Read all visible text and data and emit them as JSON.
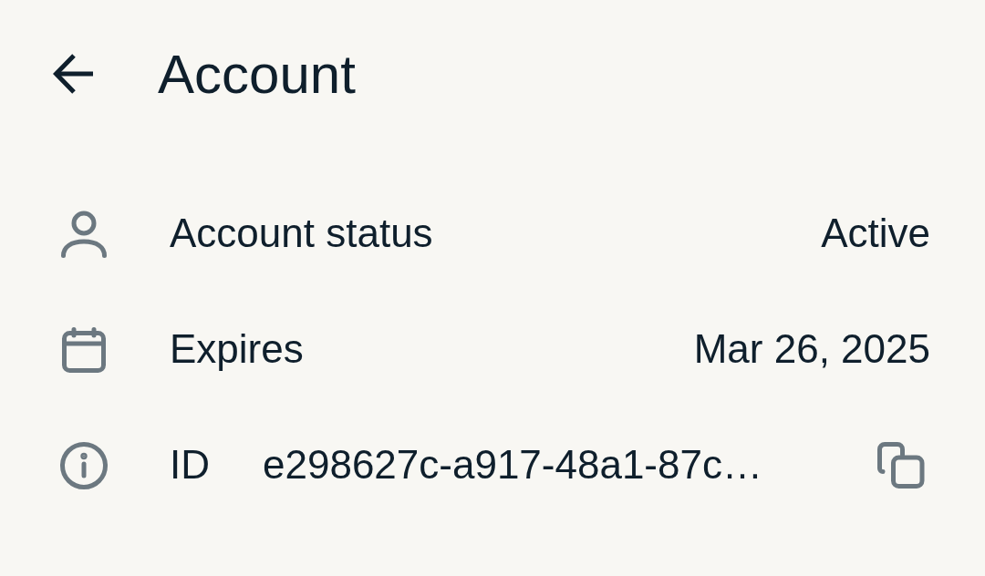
{
  "header": {
    "title": "Account"
  },
  "rows": [
    {
      "kind": "status",
      "label": "Account status",
      "value": "Active"
    },
    {
      "kind": "date",
      "label": "Expires",
      "value": "Mar 26, 2025"
    },
    {
      "kind": "id",
      "label": "ID",
      "value": "e298627c-a917-48a1-87c…"
    }
  ]
}
